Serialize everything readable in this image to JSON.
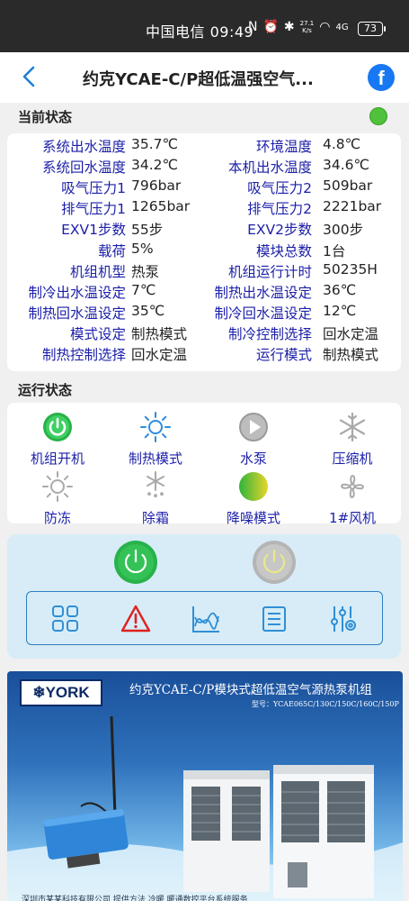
{
  "status_bar": {
    "carrier_time": "中国电信 09:49",
    "net_speed_value": "27.1",
    "net_speed_unit": "K/s",
    "signal": "4G",
    "battery": "73"
  },
  "header": {
    "title": "约克YCAE-C/P超低温强空气...",
    "back_icon": "chevron-left-icon",
    "share_icon": "facebook-icon"
  },
  "current_status": {
    "title": "当前状态",
    "indicator_color": "#4fc13b",
    "rows": [
      {
        "l1": "系统出水温度",
        "v1": "35.7℃",
        "l2": "环境温度",
        "v2": "4.8℃"
      },
      {
        "l1": "系统回水温度",
        "v1": "34.2℃",
        "l2": "本机出水温度",
        "v2": "34.6℃"
      },
      {
        "l1": "吸气压力1",
        "v1": "796bar",
        "l2": "吸气压力2",
        "v2": "509bar"
      },
      {
        "l1": "排气压力1",
        "v1": "1265bar",
        "l2": "排气压力2",
        "v2": "2221bar"
      },
      {
        "l1": "EXV1步数",
        "v1": "55步",
        "l2": "EXV2步数",
        "v2": "300步"
      },
      {
        "l1": "载荷",
        "v1": "5%",
        "l2": "模块总数",
        "v2": "1台"
      },
      {
        "l1": "机组机型",
        "v1": "热泵",
        "l2": "机组运行计时",
        "v2": "50235H"
      },
      {
        "l1": "制冷出水温设定",
        "v1": "7℃",
        "l2": "制热出水温设定",
        "v2": "36℃"
      },
      {
        "l1": "制热回水温设定",
        "v1": "35℃",
        "l2": "制冷回水温设定",
        "v2": "12℃"
      },
      {
        "l1": "模式设定",
        "v1": "制热模式",
        "l2": "制冷控制选择",
        "v2": "回水定温"
      },
      {
        "l1": "制热控制选择",
        "v1": "回水定温",
        "l2": "运行模式",
        "v2": "制热模式"
      }
    ]
  },
  "run_status": {
    "title": "运行状态",
    "items": [
      {
        "label": "机组开机",
        "icon": "power-on-icon"
      },
      {
        "label": "制热模式",
        "icon": "sun-icon"
      },
      {
        "label": "水泵",
        "icon": "pump-play-icon"
      },
      {
        "label": "压缩机",
        "icon": "snowflake-icon"
      },
      {
        "label": "防冻",
        "icon": "sun-outline-icon"
      },
      {
        "label": "除霜",
        "icon": "defrost-icon"
      },
      {
        "label": "降噪模式",
        "icon": "quiet-mode-icon"
      },
      {
        "label": "1#风机",
        "icon": "fan-icon"
      }
    ]
  },
  "controls": {
    "power_on_icon": "power-on-button-icon",
    "power_off_icon": "power-off-button-icon",
    "tools": [
      "grid-icon",
      "alarm-icon",
      "chart-icon",
      "list-icon",
      "settings-sliders-icon"
    ]
  },
  "banner": {
    "brand": "YORK",
    "title": "约克YCAE-C/P模块式超低温空气源热泵机组",
    "subtitle": "型号：YCAE065C/130C/150C/160C/150P",
    "footer": "深圳市某某科技有限公司    提供方法  冷暖  暖通数控平台系统服务"
  }
}
